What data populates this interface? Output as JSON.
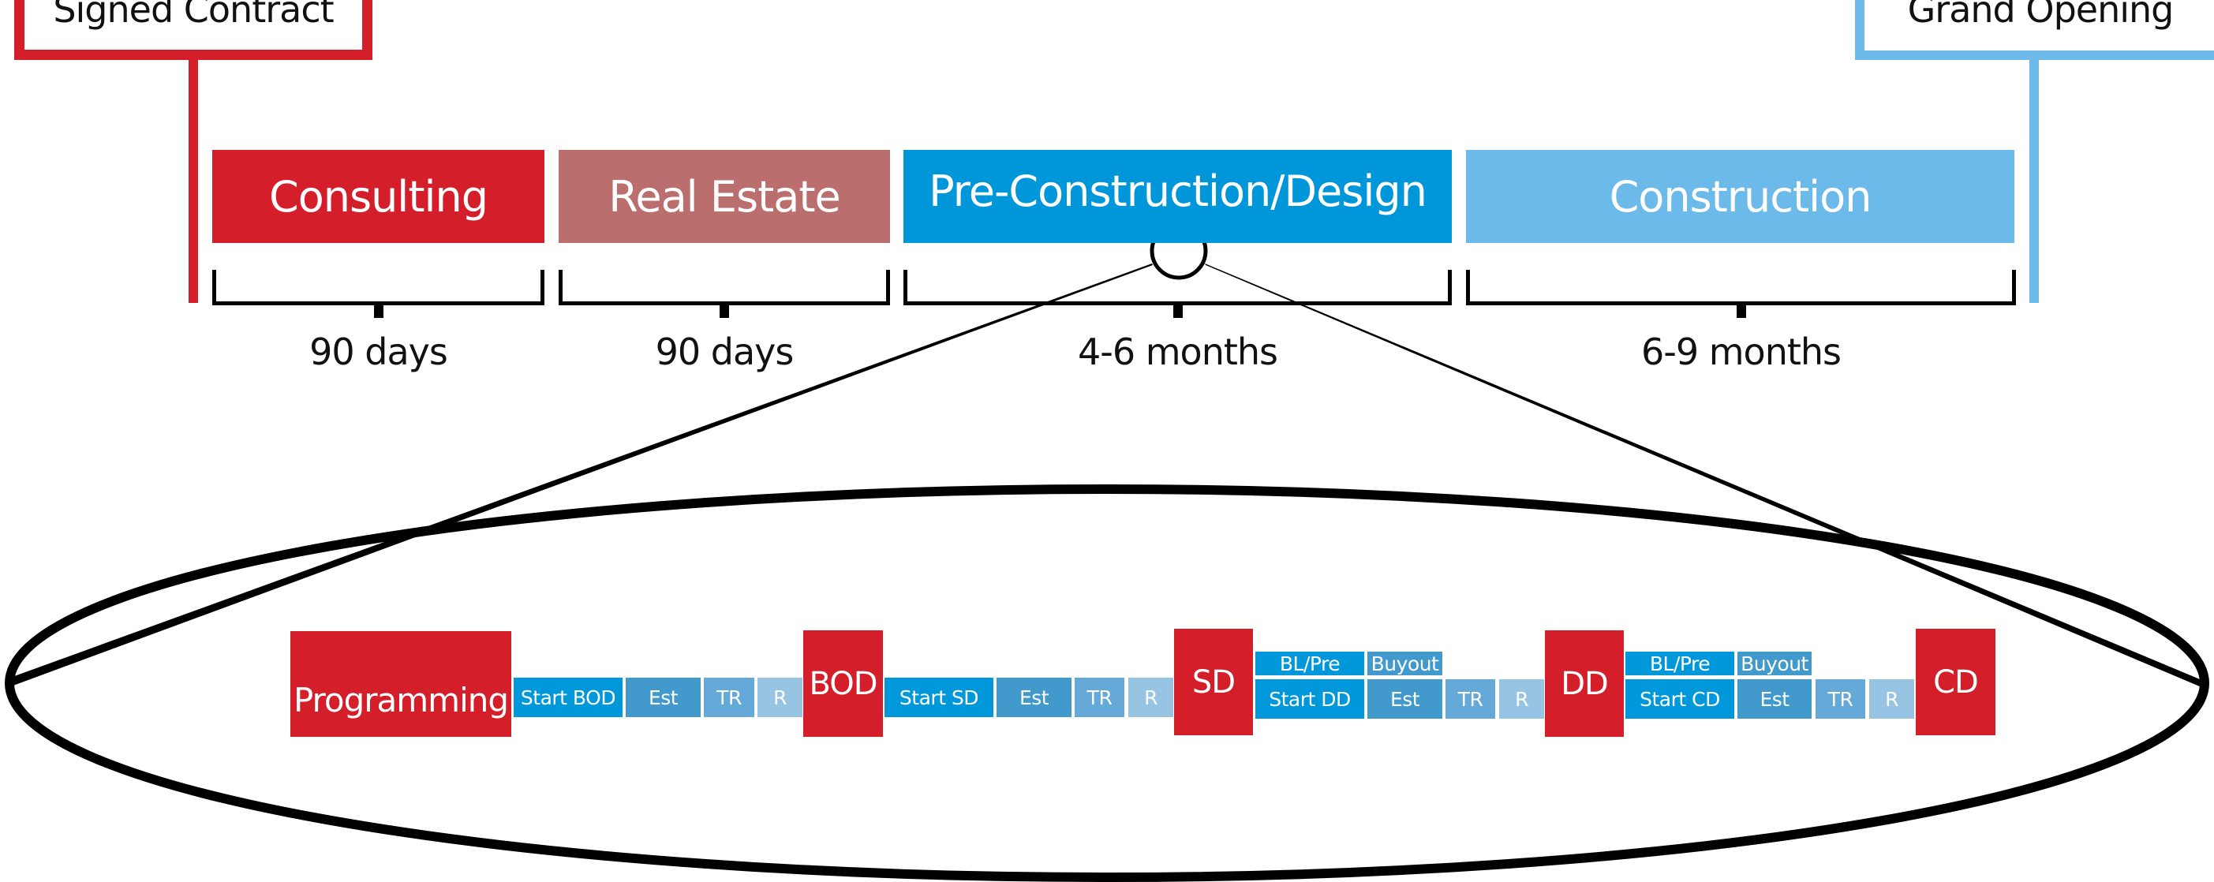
{
  "milestones": {
    "start": {
      "label": "Signed Contract",
      "color": "#D41E2A"
    },
    "end": {
      "label": "Grand Opening",
      "color": "#6BBAE9"
    }
  },
  "phases": [
    {
      "label": "Consulting",
      "duration": "90 days",
      "color": "#D41E2A"
    },
    {
      "label": "Real Estate",
      "duration": "90 days",
      "color": "#BA6E6E"
    },
    {
      "label": "Pre-Construction/Design",
      "duration": "4-6 months",
      "color": "#0096DA"
    },
    {
      "label": "Construction",
      "duration": "6-9 months",
      "color": "#6BBAE9"
    }
  ],
  "detail": {
    "zoom_of": "Pre-Construction/Design",
    "gates": [
      "Programming",
      "BOD",
      "SD",
      "DD",
      "CD"
    ],
    "groups": [
      {
        "tasks": [
          "Start BOD",
          "Est",
          "TR",
          "R"
        ],
        "extras": []
      },
      {
        "tasks": [
          "Start SD",
          "Est",
          "TR",
          "R"
        ],
        "extras": []
      },
      {
        "tasks": [
          "Start DD",
          "Est",
          "TR",
          "R"
        ],
        "extras": [
          "BL/Pre",
          "Buyout"
        ]
      },
      {
        "tasks": [
          "Start CD",
          "Est",
          "TR",
          "R"
        ],
        "extras": [
          "BL/Pre",
          "Buyout"
        ]
      }
    ],
    "task_colors": {
      "start": "#0098DB",
      "est": "#419ACB",
      "tr": "#64A9D8",
      "r": "#97C4E3",
      "bl_pre": "#0098DB",
      "buyout": "#419ACB"
    }
  }
}
